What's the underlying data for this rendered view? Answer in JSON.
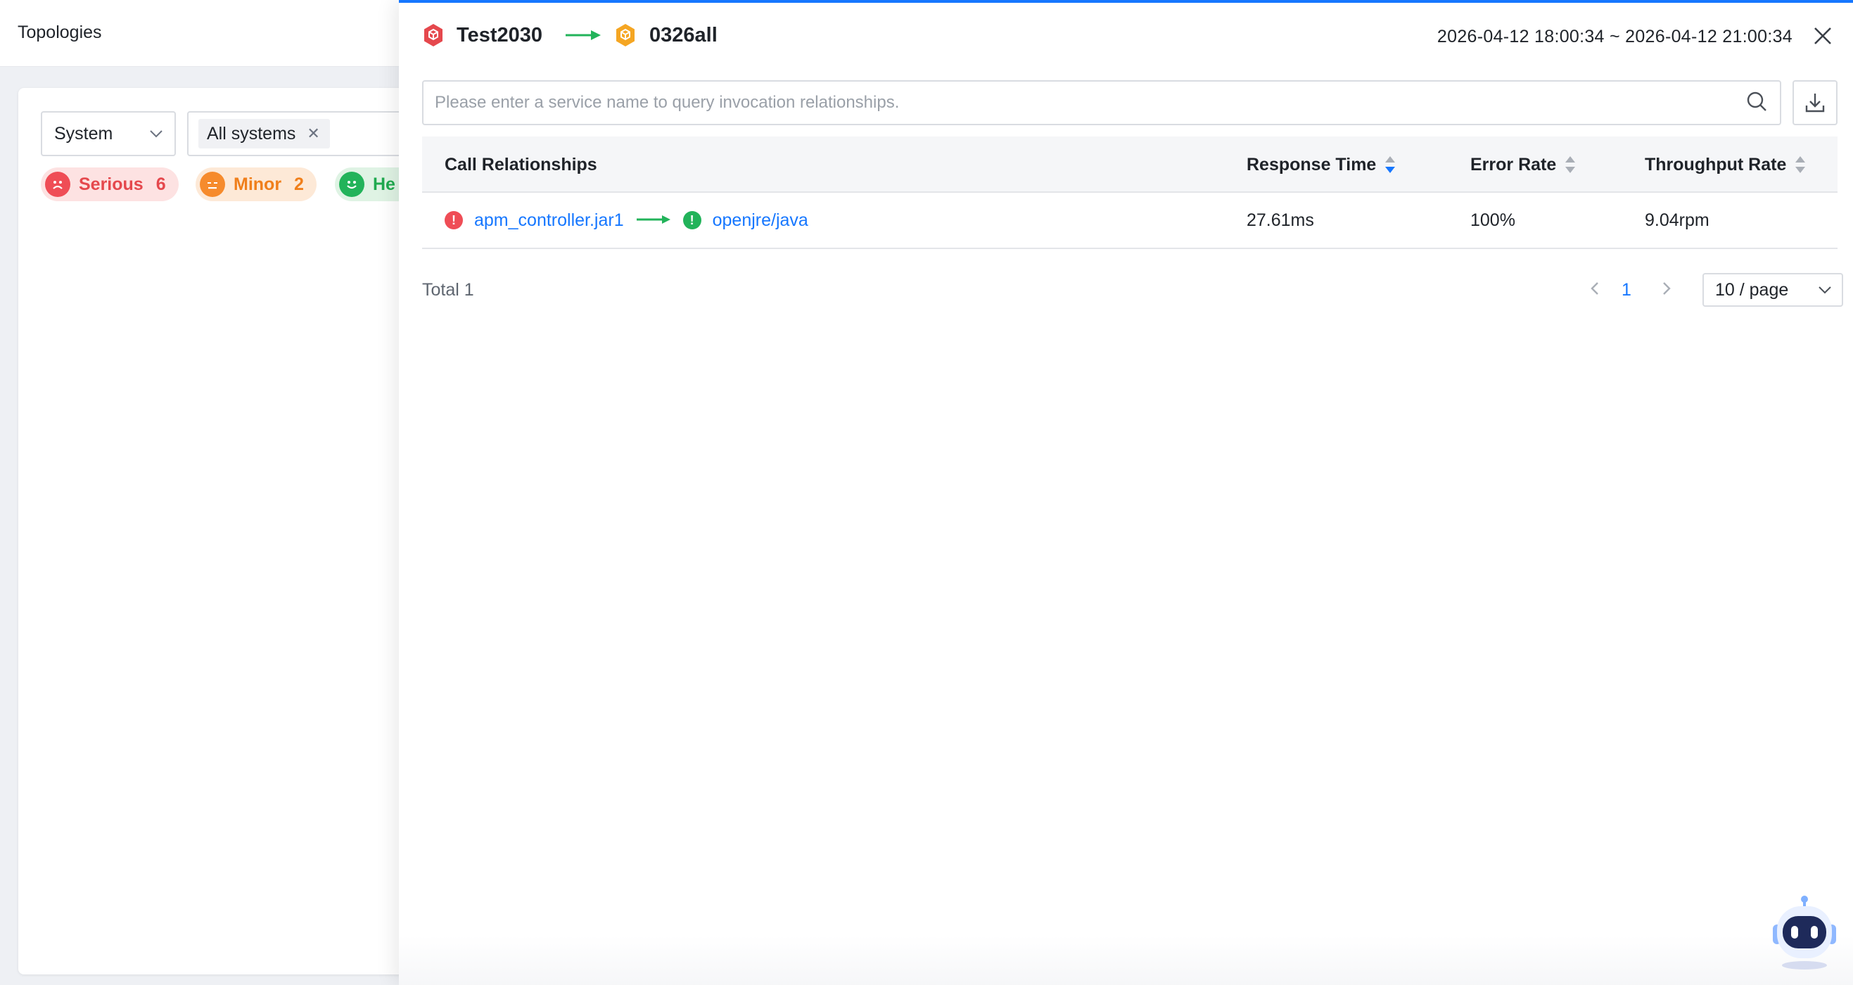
{
  "page": {
    "title": "Topologies"
  },
  "filters": {
    "dimension_select": "System",
    "tag": "All systems",
    "status": [
      {
        "label": "Serious",
        "count": "6",
        "color": "#e5484d"
      },
      {
        "label": "Minor",
        "count": "2",
        "color": "#f07f1b"
      },
      {
        "label": "He",
        "count": "",
        "color": "#1faa4f"
      }
    ]
  },
  "drawer": {
    "source_node": "Test2030",
    "target_node": "0326all",
    "source_color": "#e5484d",
    "target_color": "#f5a623",
    "time_range": "2026-04-12 18:00:34 ~ 2026-04-12 21:00:34",
    "search": {
      "placeholder": "Please enter a service name to query invocation relationships.",
      "value": ""
    },
    "table": {
      "columns": [
        "Call Relationships",
        "Response Time",
        "Error Rate",
        "Throughput Rate"
      ],
      "rows": [
        {
          "from": "apm_controller.jar1",
          "from_status": "error",
          "to": "openjre/java",
          "to_status": "ok",
          "response_time": "27.61ms",
          "error_rate": "100%",
          "throughput_rate": "9.04rpm"
        }
      ]
    },
    "pagination": {
      "total": "Total 1",
      "current_page": "1",
      "page_size": "10 / page"
    }
  },
  "colors": {
    "accent": "#1677ff",
    "arrow": "#22b35a"
  }
}
